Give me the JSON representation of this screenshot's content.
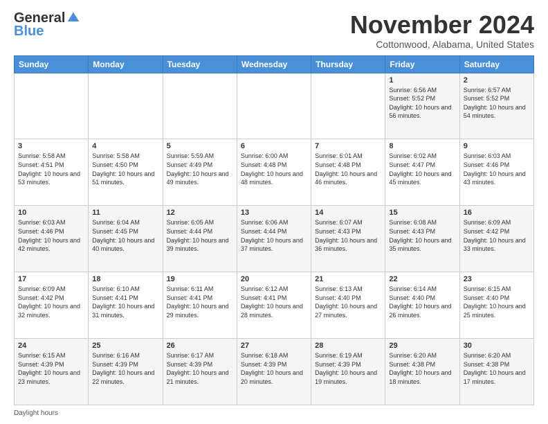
{
  "logo": {
    "general": "General",
    "blue": "Blue"
  },
  "header": {
    "month": "November 2024",
    "location": "Cottonwood, Alabama, United States"
  },
  "weekdays": [
    "Sunday",
    "Monday",
    "Tuesday",
    "Wednesday",
    "Thursday",
    "Friday",
    "Saturday"
  ],
  "weeks": [
    [
      {
        "day": "",
        "info": ""
      },
      {
        "day": "",
        "info": ""
      },
      {
        "day": "",
        "info": ""
      },
      {
        "day": "",
        "info": ""
      },
      {
        "day": "",
        "info": ""
      },
      {
        "day": "1",
        "info": "Sunrise: 6:56 AM\nSunset: 5:52 PM\nDaylight: 10 hours and 56 minutes."
      },
      {
        "day": "2",
        "info": "Sunrise: 6:57 AM\nSunset: 5:52 PM\nDaylight: 10 hours and 54 minutes."
      }
    ],
    [
      {
        "day": "3",
        "info": "Sunrise: 5:58 AM\nSunset: 4:51 PM\nDaylight: 10 hours and 53 minutes."
      },
      {
        "day": "4",
        "info": "Sunrise: 5:58 AM\nSunset: 4:50 PM\nDaylight: 10 hours and 51 minutes."
      },
      {
        "day": "5",
        "info": "Sunrise: 5:59 AM\nSunset: 4:49 PM\nDaylight: 10 hours and 49 minutes."
      },
      {
        "day": "6",
        "info": "Sunrise: 6:00 AM\nSunset: 4:48 PM\nDaylight: 10 hours and 48 minutes."
      },
      {
        "day": "7",
        "info": "Sunrise: 6:01 AM\nSunset: 4:48 PM\nDaylight: 10 hours and 46 minutes."
      },
      {
        "day": "8",
        "info": "Sunrise: 6:02 AM\nSunset: 4:47 PM\nDaylight: 10 hours and 45 minutes."
      },
      {
        "day": "9",
        "info": "Sunrise: 6:03 AM\nSunset: 4:46 PM\nDaylight: 10 hours and 43 minutes."
      }
    ],
    [
      {
        "day": "10",
        "info": "Sunrise: 6:03 AM\nSunset: 4:46 PM\nDaylight: 10 hours and 42 minutes."
      },
      {
        "day": "11",
        "info": "Sunrise: 6:04 AM\nSunset: 4:45 PM\nDaylight: 10 hours and 40 minutes."
      },
      {
        "day": "12",
        "info": "Sunrise: 6:05 AM\nSunset: 4:44 PM\nDaylight: 10 hours and 39 minutes."
      },
      {
        "day": "13",
        "info": "Sunrise: 6:06 AM\nSunset: 4:44 PM\nDaylight: 10 hours and 37 minutes."
      },
      {
        "day": "14",
        "info": "Sunrise: 6:07 AM\nSunset: 4:43 PM\nDaylight: 10 hours and 36 minutes."
      },
      {
        "day": "15",
        "info": "Sunrise: 6:08 AM\nSunset: 4:43 PM\nDaylight: 10 hours and 35 minutes."
      },
      {
        "day": "16",
        "info": "Sunrise: 6:09 AM\nSunset: 4:42 PM\nDaylight: 10 hours and 33 minutes."
      }
    ],
    [
      {
        "day": "17",
        "info": "Sunrise: 6:09 AM\nSunset: 4:42 PM\nDaylight: 10 hours and 32 minutes."
      },
      {
        "day": "18",
        "info": "Sunrise: 6:10 AM\nSunset: 4:41 PM\nDaylight: 10 hours and 31 minutes."
      },
      {
        "day": "19",
        "info": "Sunrise: 6:11 AM\nSunset: 4:41 PM\nDaylight: 10 hours and 29 minutes."
      },
      {
        "day": "20",
        "info": "Sunrise: 6:12 AM\nSunset: 4:41 PM\nDaylight: 10 hours and 28 minutes."
      },
      {
        "day": "21",
        "info": "Sunrise: 6:13 AM\nSunset: 4:40 PM\nDaylight: 10 hours and 27 minutes."
      },
      {
        "day": "22",
        "info": "Sunrise: 6:14 AM\nSunset: 4:40 PM\nDaylight: 10 hours and 26 minutes."
      },
      {
        "day": "23",
        "info": "Sunrise: 6:15 AM\nSunset: 4:40 PM\nDaylight: 10 hours and 25 minutes."
      }
    ],
    [
      {
        "day": "24",
        "info": "Sunrise: 6:15 AM\nSunset: 4:39 PM\nDaylight: 10 hours and 23 minutes."
      },
      {
        "day": "25",
        "info": "Sunrise: 6:16 AM\nSunset: 4:39 PM\nDaylight: 10 hours and 22 minutes."
      },
      {
        "day": "26",
        "info": "Sunrise: 6:17 AM\nSunset: 4:39 PM\nDaylight: 10 hours and 21 minutes."
      },
      {
        "day": "27",
        "info": "Sunrise: 6:18 AM\nSunset: 4:39 PM\nDaylight: 10 hours and 20 minutes."
      },
      {
        "day": "28",
        "info": "Sunrise: 6:19 AM\nSunset: 4:39 PM\nDaylight: 10 hours and 19 minutes."
      },
      {
        "day": "29",
        "info": "Sunrise: 6:20 AM\nSunset: 4:38 PM\nDaylight: 10 hours and 18 minutes."
      },
      {
        "day": "30",
        "info": "Sunrise: 6:20 AM\nSunset: 4:38 PM\nDaylight: 10 hours and 17 minutes."
      }
    ]
  ],
  "footer": {
    "daylight_label": "Daylight hours"
  }
}
